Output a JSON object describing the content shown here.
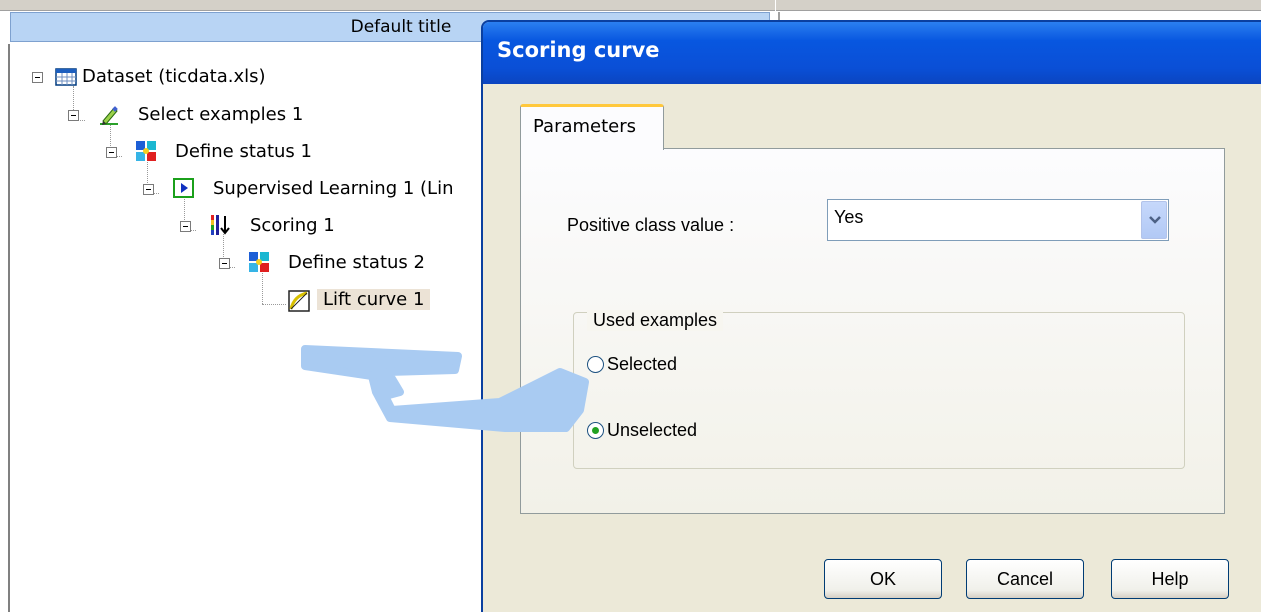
{
  "tree_pane": {
    "header": "Default title",
    "nodes": [
      {
        "label": "Dataset (ticdata.xls)",
        "icon": "table-icon"
      },
      {
        "label": "Select examples 1",
        "icon": "pencil-icon"
      },
      {
        "label": "Define status 1",
        "icon": "define-status-icon"
      },
      {
        "label": "Supervised Learning 1 (Lin",
        "icon": "play-icon"
      },
      {
        "label": "Scoring 1",
        "icon": "scoring-icon"
      },
      {
        "label": "Define status 2",
        "icon": "define-status-icon"
      },
      {
        "label": "Lift curve 1",
        "icon": "curve-icon"
      }
    ]
  },
  "dialog": {
    "title": "Scoring curve",
    "tab": "Parameters",
    "positive_class_label": "Positive class value :",
    "positive_class_value": "Yes",
    "used_examples": {
      "legend": "Used examples",
      "options": [
        {
          "label": "Selected",
          "checked": false
        },
        {
          "label": "Unselected",
          "checked": true
        }
      ]
    },
    "buttons": {
      "ok": "OK",
      "cancel": "Cancel",
      "help": "Help"
    }
  },
  "colors": {
    "titlebar": "#0a4fd6",
    "header_bg": "#b8d4f4",
    "annotation_stroke": "#a9cbf2",
    "tab_highlight": "#ffc83c"
  }
}
